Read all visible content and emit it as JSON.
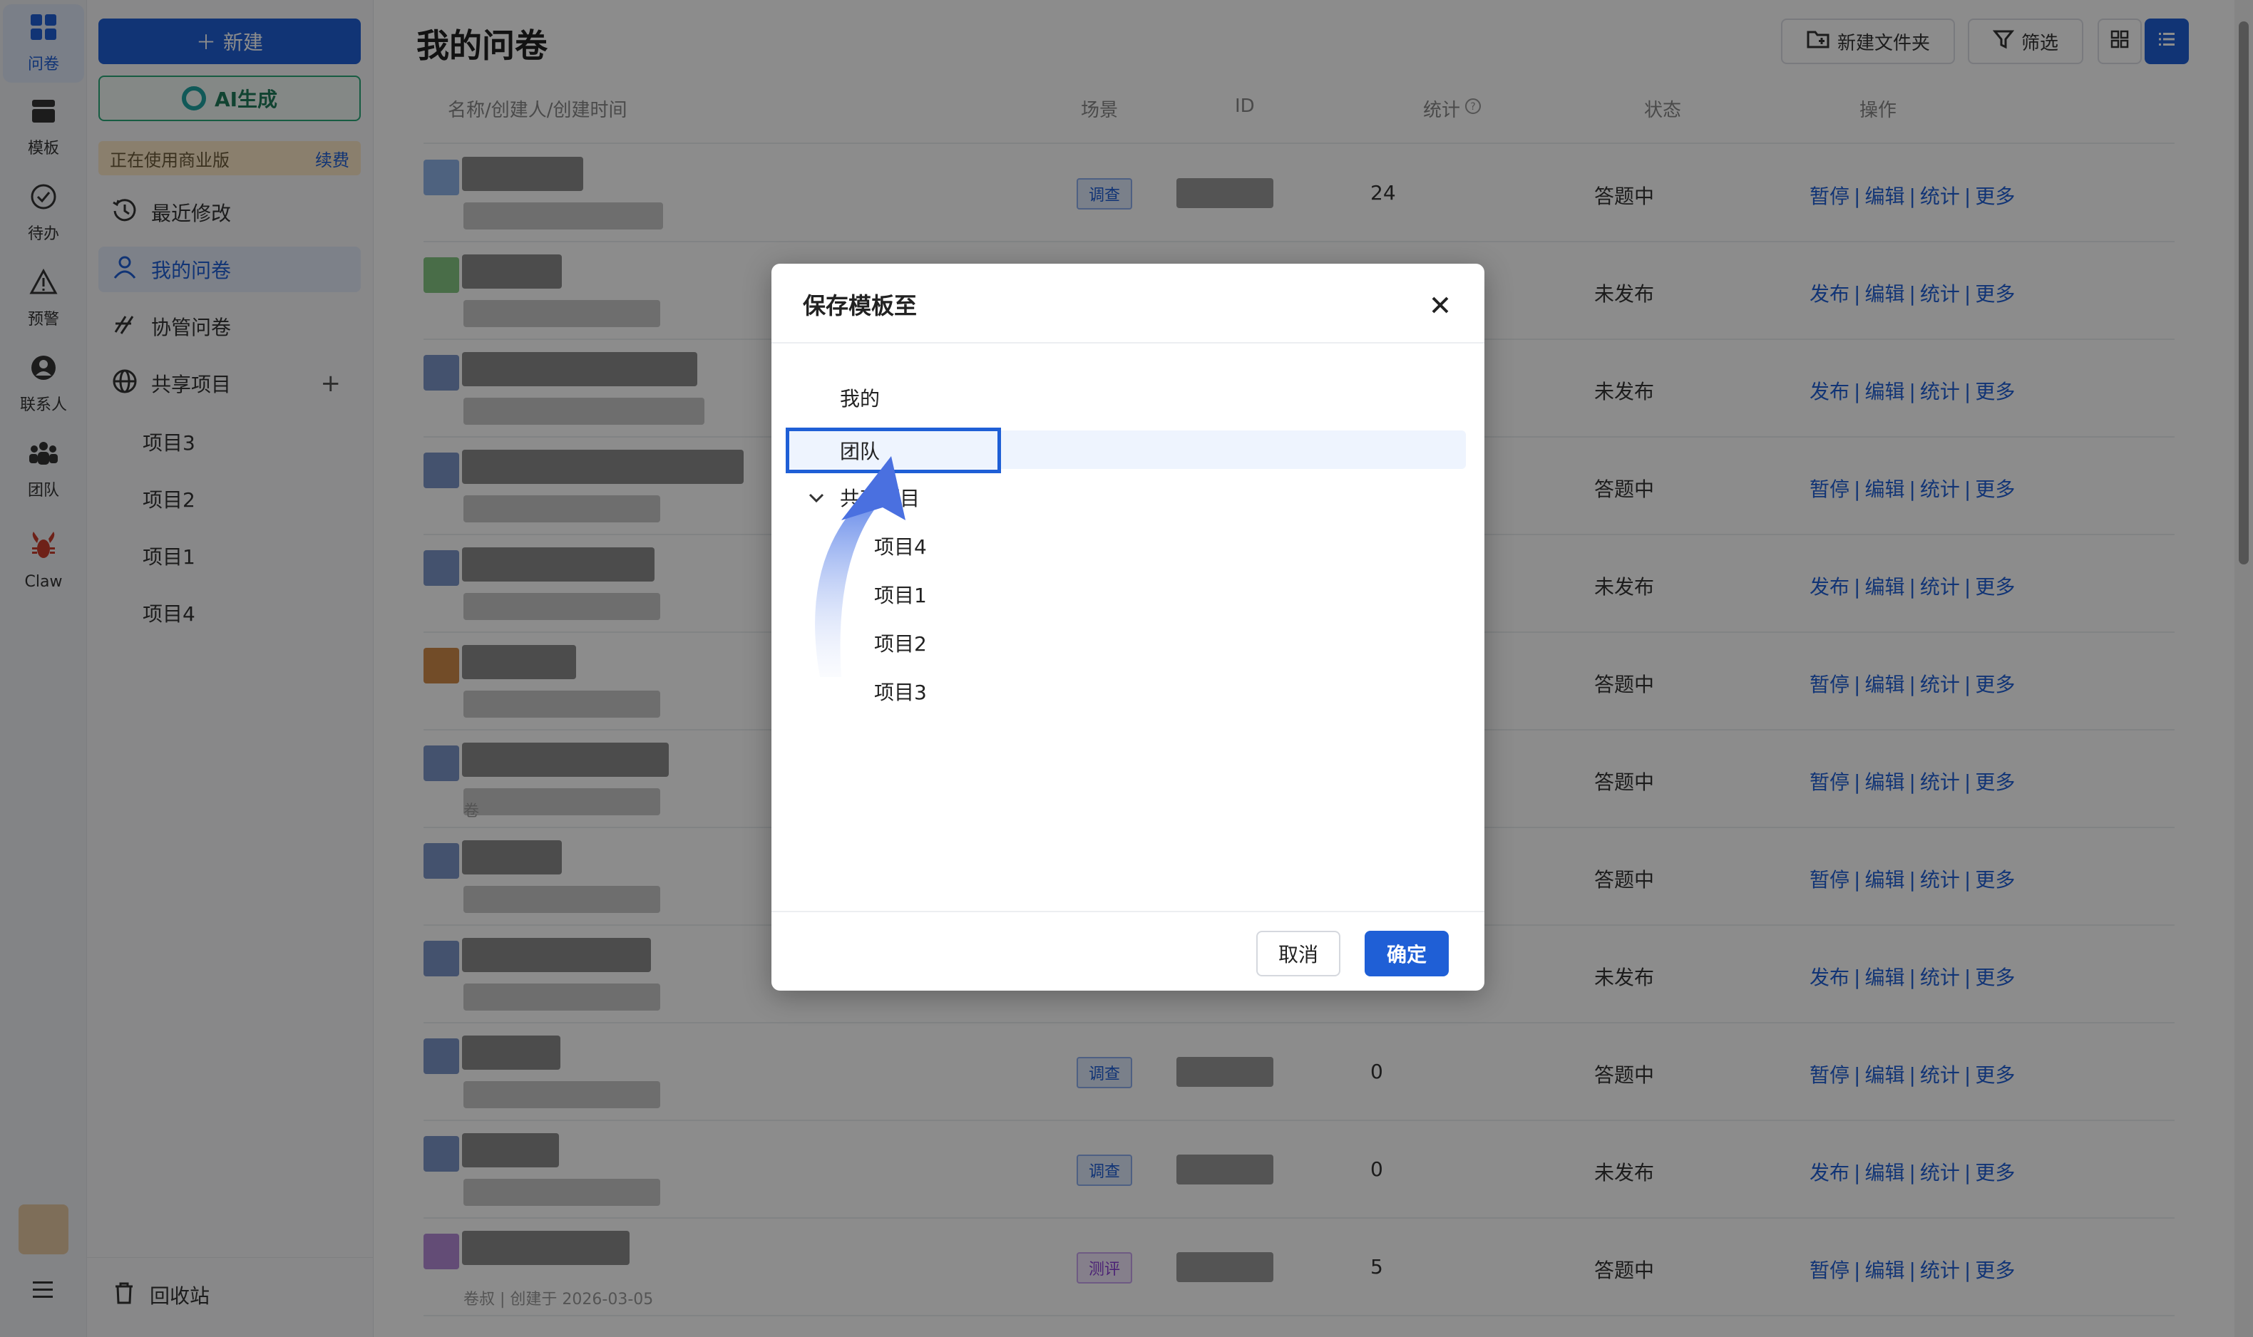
{
  "rail": {
    "items": [
      {
        "label": "问卷",
        "icon": "grid-icon"
      },
      {
        "label": "模板",
        "icon": "template-icon"
      },
      {
        "label": "待办",
        "icon": "check-circle-icon"
      },
      {
        "label": "预警",
        "icon": "warning-icon"
      },
      {
        "label": "联系人",
        "icon": "contact-icon"
      },
      {
        "label": "团队",
        "icon": "team-icon"
      },
      {
        "label": "Claw",
        "icon": "lobster-icon"
      }
    ]
  },
  "sidebar": {
    "new_label": "新建",
    "ai_label": "AI生成",
    "biz_text": "正在使用商业版",
    "renew": "续费",
    "nav": [
      {
        "label": "最近修改",
        "icon": "history-icon"
      },
      {
        "label": "我的问卷",
        "icon": "user-icon"
      },
      {
        "label": "协管问卷",
        "icon": "co-manage-icon"
      },
      {
        "label": "共享项目",
        "icon": "globe-icon"
      }
    ],
    "projects": [
      "项目3",
      "项目2",
      "项目1",
      "项目4"
    ],
    "recycle": "回收站"
  },
  "main": {
    "title": "我的问卷",
    "toolbar": {
      "new_folder": "新建文件夹",
      "filter": "筛选"
    },
    "columns": {
      "name": "名称/创建人/创建时间",
      "scene": "场景",
      "id": "ID",
      "stats": "统计",
      "status": "状态",
      "ops": "操作"
    },
    "rows": [
      {
        "thumb": "#8fb3e8",
        "scene": "调查",
        "count": "24",
        "status": "答题中",
        "ops": [
          "暂停",
          "编辑",
          "统计",
          "更多"
        ],
        "meta": ""
      },
      {
        "thumb": "#86c784",
        "scene": "",
        "count": "",
        "status": "未发布",
        "ops": [
          "发布",
          "编辑",
          "统计",
          "更多"
        ],
        "meta": ""
      },
      {
        "thumb": "#7d96c9",
        "scene": "",
        "count": "",
        "status": "未发布",
        "ops": [
          "发布",
          "编辑",
          "统计",
          "更多"
        ],
        "meta": ""
      },
      {
        "thumb": "#7d96c9",
        "scene": "",
        "count": "",
        "status": "答题中",
        "ops": [
          "暂停",
          "编辑",
          "统计",
          "更多"
        ],
        "meta": ""
      },
      {
        "thumb": "#7d96c9",
        "scene": "",
        "count": "",
        "status": "未发布",
        "ops": [
          "发布",
          "编辑",
          "统计",
          "更多"
        ],
        "meta": ""
      },
      {
        "thumb": "#d08a4a",
        "scene": "",
        "count": "",
        "status": "答题中",
        "ops": [
          "暂停",
          "编辑",
          "统计",
          "更多"
        ],
        "meta": ""
      },
      {
        "thumb": "#7d96c9",
        "scene": "",
        "count": "",
        "status": "答题中",
        "ops": [
          "暂停",
          "编辑",
          "统计",
          "更多"
        ],
        "meta": "卷"
      },
      {
        "thumb": "#7d96c9",
        "scene": "",
        "count": "",
        "status": "答题中",
        "ops": [
          "暂停",
          "编辑",
          "统计",
          "更多"
        ],
        "meta": ""
      },
      {
        "thumb": "#7d96c9",
        "scene": "",
        "count": "",
        "status": "未发布",
        "ops": [
          "发布",
          "编辑",
          "统计",
          "更多"
        ],
        "meta": ""
      },
      {
        "thumb": "#7d96c9",
        "scene": "调查",
        "count": "0",
        "status": "答题中",
        "ops": [
          "暂停",
          "编辑",
          "统计",
          "更多"
        ],
        "meta": ""
      },
      {
        "thumb": "#7d96c9",
        "scene": "调查",
        "count": "0",
        "status": "未发布",
        "ops": [
          "发布",
          "编辑",
          "统计",
          "更多"
        ],
        "meta": ""
      },
      {
        "thumb": "#b48ad8",
        "scene": "测评",
        "count": "5",
        "status": "答题中",
        "ops": [
          "暂停",
          "编辑",
          "统计",
          "更多"
        ],
        "meta": "卷叔 | 创建于 2026-03-05"
      }
    ]
  },
  "modal": {
    "title": "保存模板至",
    "tree": {
      "mine": "我的",
      "team": "团队",
      "shared": "共享项目",
      "projects": [
        "项目4",
        "项目1",
        "项目2",
        "项目3"
      ]
    },
    "cancel": "取消",
    "confirm": "确定"
  },
  "colors": {
    "accent": "#1f5fd6",
    "overlay": "rgba(0,0,0,0.45)"
  }
}
